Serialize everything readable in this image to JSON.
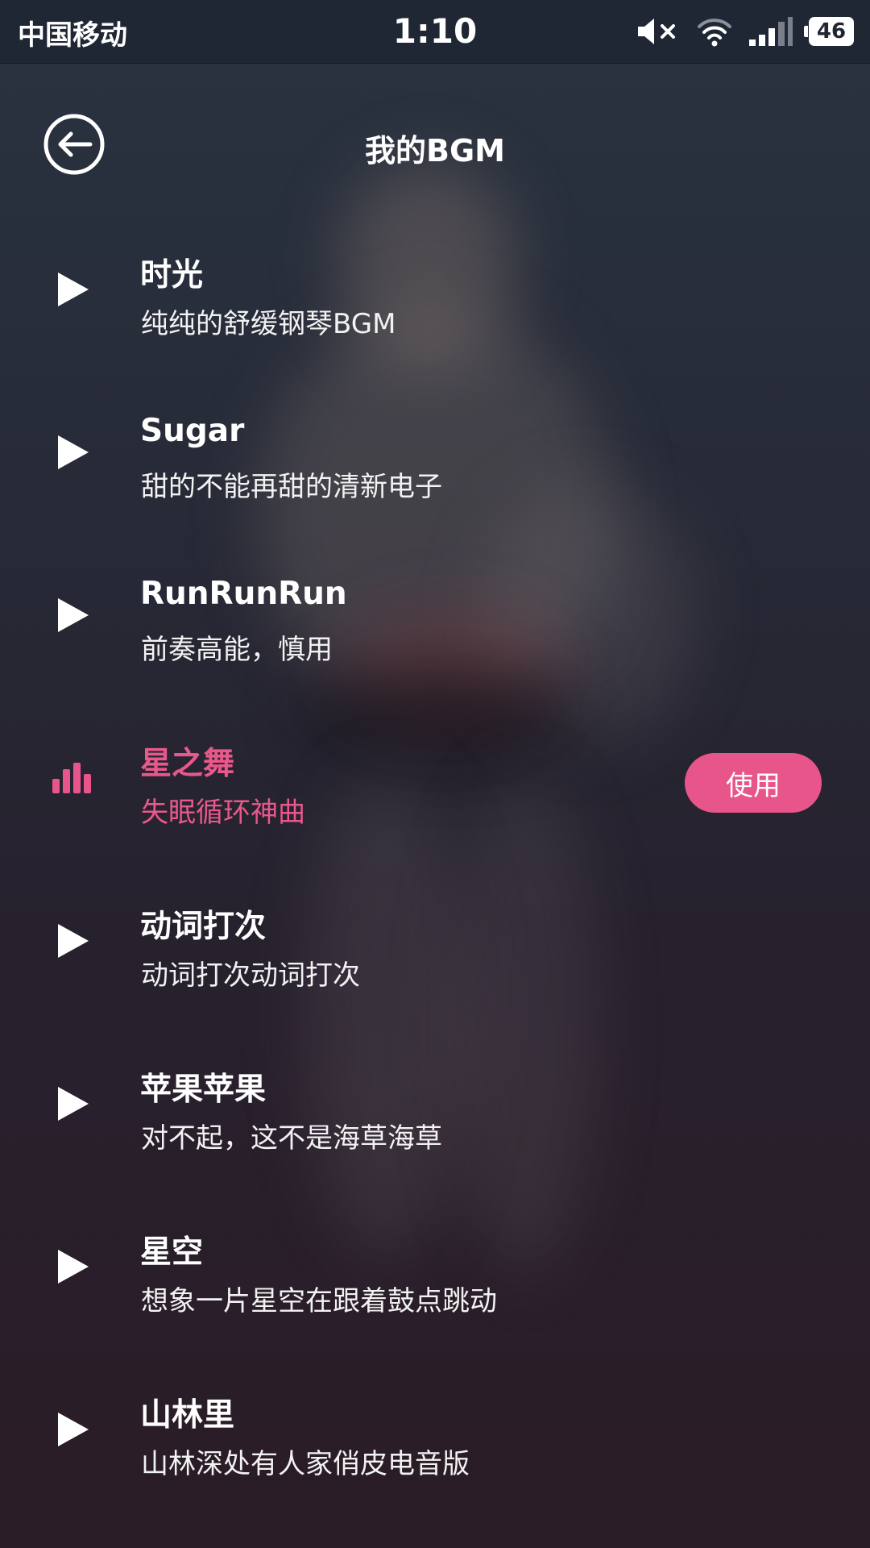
{
  "status_bar": {
    "carrier": "中国移动",
    "time": "1:10",
    "battery": "46",
    "icons": [
      "mute-icon",
      "wifi-icon",
      "signal-icon",
      "battery-icon"
    ]
  },
  "header": {
    "title": "我的BGM",
    "back_icon": "back-arrow-circle-icon"
  },
  "colors": {
    "accent": "#e8558a",
    "text": "#ffffff"
  },
  "bgm_list": [
    {
      "title": "时光",
      "subtitle": "纯纯的舒缓钢琴BGM",
      "state": "play-icon"
    },
    {
      "title": "Sugar",
      "subtitle": "甜的不能再甜的清新电子",
      "state": "play-icon"
    },
    {
      "title": "RunRunRun",
      "subtitle": "前奏高能，慎用",
      "state": "play-icon"
    },
    {
      "title": "星之舞",
      "subtitle": "失眠循环神曲",
      "state": "playing-bars-icon",
      "action_label": "使用"
    },
    {
      "title": "动词打次",
      "subtitle": "动词打次动词打次",
      "state": "play-icon"
    },
    {
      "title": "苹果苹果",
      "subtitle": "对不起，这不是海草海草",
      "state": "play-icon"
    },
    {
      "title": "星空",
      "subtitle": "想象一片星空在跟着鼓点跳动",
      "state": "play-icon"
    },
    {
      "title": "山林里",
      "subtitle": "山林深处有人家俏皮电音版",
      "state": "play-icon"
    }
  ]
}
